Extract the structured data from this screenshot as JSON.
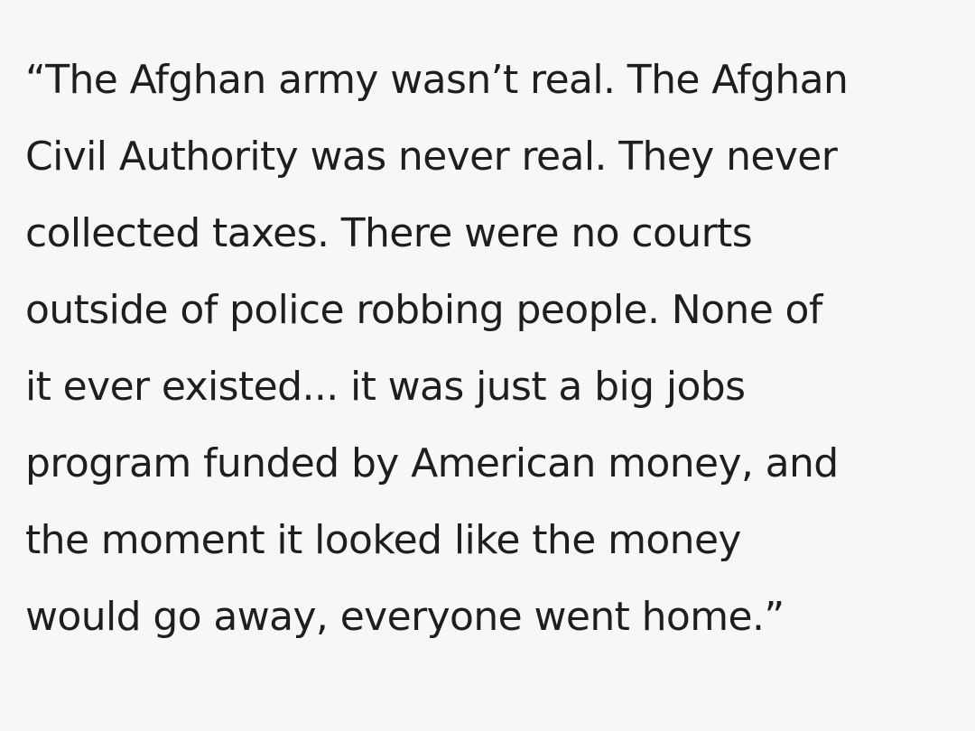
{
  "quote": {
    "lines": [
      "“The Afghan army wasn’t real. The Afghan",
      "Civil Authority was never real. They never",
      "collected taxes. There were no courts",
      "outside of police robbing people. None of",
      "it ever existed... it was just a big jobs",
      "program funded by American money, and",
      "the moment it looked like the money",
      "would go away, everyone went home.”"
    ]
  },
  "colors": {
    "background": "#f7f7f7",
    "text": "#1e1e1e"
  }
}
